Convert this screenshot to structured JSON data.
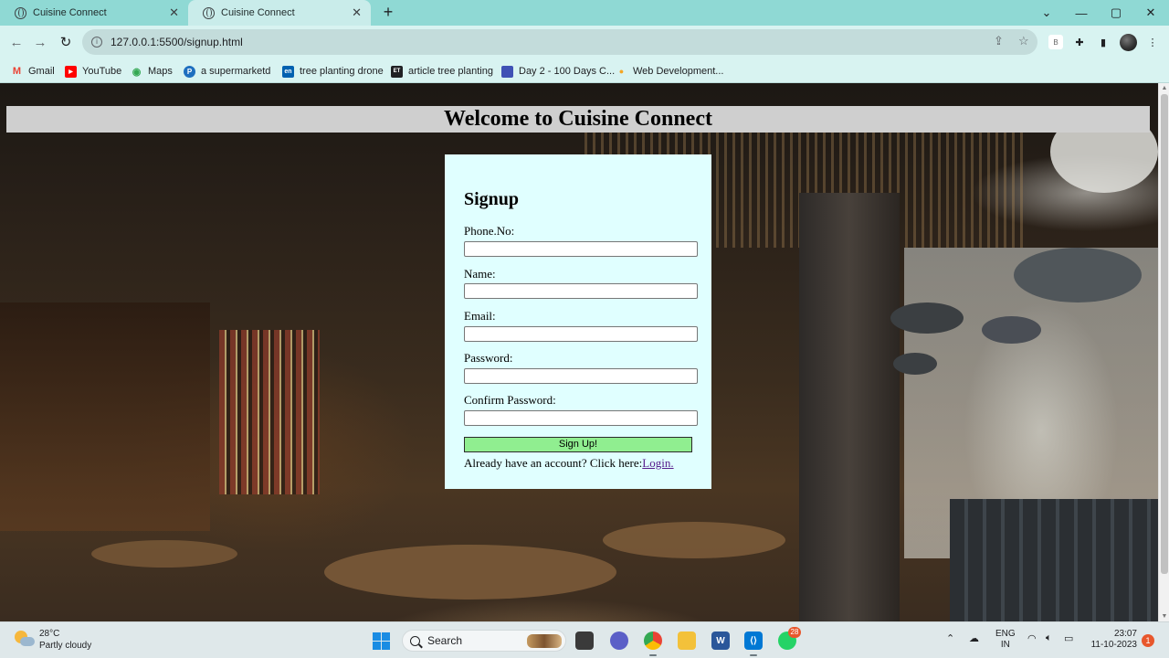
{
  "browser": {
    "tabs": [
      {
        "title": "Cuisine Connect",
        "active": false
      },
      {
        "title": "Cuisine Connect",
        "active": true
      }
    ],
    "new_tab": "+",
    "window_controls": {
      "dropdown": "⌄",
      "minimize": "—",
      "maximize": "▢",
      "close": "✕"
    },
    "close_tab": "✕",
    "url": "127.0.0.1:5500/signup.html",
    "bookmarks": [
      {
        "label": "Gmail",
        "icon": "gmail-icon",
        "color": "#ea4335",
        "glyph": "M"
      },
      {
        "label": "YouTube",
        "icon": "youtube-icon",
        "color": "#ff0000",
        "glyph": "▶"
      },
      {
        "label": "Maps",
        "icon": "maps-icon",
        "color": "#34a853",
        "glyph": "◉"
      },
      {
        "label": "a  supermarketd",
        "icon": "p-site-icon",
        "color": "#1e6fbf",
        "glyph": "P"
      },
      {
        "label": "tree planting drone",
        "icon": "en-site-icon",
        "color": "#0061b0",
        "glyph": "en"
      },
      {
        "label": "article tree planting",
        "icon": "et-site-icon",
        "color": "#202124",
        "glyph": "ET"
      },
      {
        "label": "Day 2 - 100 Days C...",
        "icon": "course-site-icon",
        "color": "#3f51b5",
        "glyph": ""
      },
      {
        "label": "Web Development...",
        "icon": "webdev-site-icon",
        "color": "#f5a623",
        "glyph": "●"
      }
    ]
  },
  "page": {
    "welcome": "Welcome to Cuisine Connect",
    "form": {
      "title": "Signup",
      "fields": [
        {
          "label": "Phone.No:",
          "value": ""
        },
        {
          "label": "Name:",
          "value": ""
        },
        {
          "label": "Email:",
          "value": ""
        },
        {
          "label": "Password:",
          "value": ""
        },
        {
          "label": "Confirm Password:",
          "value": ""
        }
      ],
      "submit_label": "Sign Up!",
      "login_prompt": "Already have an account? Click here:",
      "login_link": "Login."
    }
  },
  "taskbar": {
    "weather_temp": "28°C",
    "weather_cond": "Partly cloudy",
    "search_label": "Search",
    "whatsapp_badge": "28",
    "lang_line1": "ENG",
    "lang_line2": "IN",
    "time": "23:07",
    "date": "11-10-2023",
    "notification_count": "1"
  }
}
